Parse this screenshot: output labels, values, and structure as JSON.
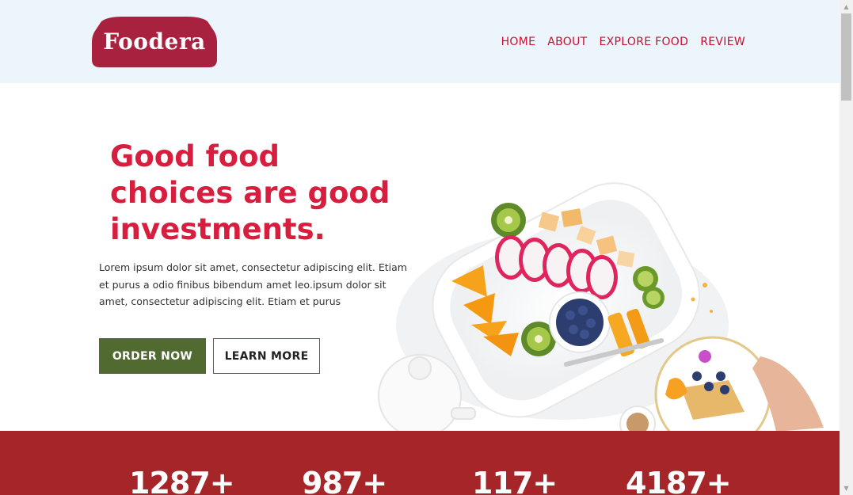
{
  "brand": {
    "logo_text": "Foodera",
    "color": "#a8213f"
  },
  "nav": {
    "items": [
      {
        "label": "HOME"
      },
      {
        "label": "ABOUT"
      },
      {
        "label": "EXPLORE FOOD"
      },
      {
        "label": "REVIEW"
      }
    ]
  },
  "hero": {
    "title_lines": [
      "Good food",
      "choices are good",
      "investments."
    ],
    "description": "Lorem ipsum dolor sit amet, consectetur adipiscing elit. Etiam et purus a odio finibus bibendum amet leo.ipsum dolor sit amet, consectetur adipiscing elit. Etiam et purus",
    "order_label": "ORDER NOW",
    "learn_label": "LEARN MORE"
  },
  "stats": {
    "items": [
      {
        "value": "1287+"
      },
      {
        "value": "987+"
      },
      {
        "value": "117+"
      },
      {
        "value": "4187+"
      }
    ]
  },
  "colors": {
    "header_bg": "#ecf4fc",
    "accent_red": "#d81e3e",
    "nav_red": "#c8102e",
    "button_green": "#516a2f",
    "stats_bg": "#a52528"
  }
}
